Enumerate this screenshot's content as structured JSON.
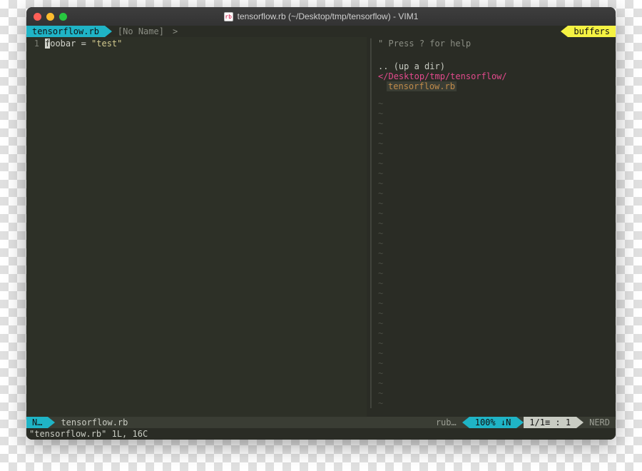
{
  "titlebar": {
    "icon_text": "rb",
    "title": "tensorflow.rb (~/Desktop/tmp/tensorflow) - VIM1"
  },
  "bufline": {
    "active_tab": "tensorflow.rb",
    "inactive_tab": "[No Name]",
    "sep": ">",
    "buffers_label": "buffers"
  },
  "editor": {
    "line_no": "1",
    "code_prefix": "f",
    "code_mid": "oobar = ",
    "code_string": "\"test\""
  },
  "nerdtree": {
    "help": "\" Press ? for help",
    "updir": ".. (up a dir)",
    "path_prefix": "</",
    "path_rest": "Desktop/tmp/tensorflow/",
    "selected": "tensorflow.rb"
  },
  "statusline": {
    "mode": "N…",
    "file": "tensorflow.rb",
    "filetype": "rub…",
    "percent": "100% ↓N",
    "position": "1/1≡ :  1",
    "right_label": "NERD"
  },
  "cmdline": "\"tensorflow.rb\" 1L, 16C"
}
